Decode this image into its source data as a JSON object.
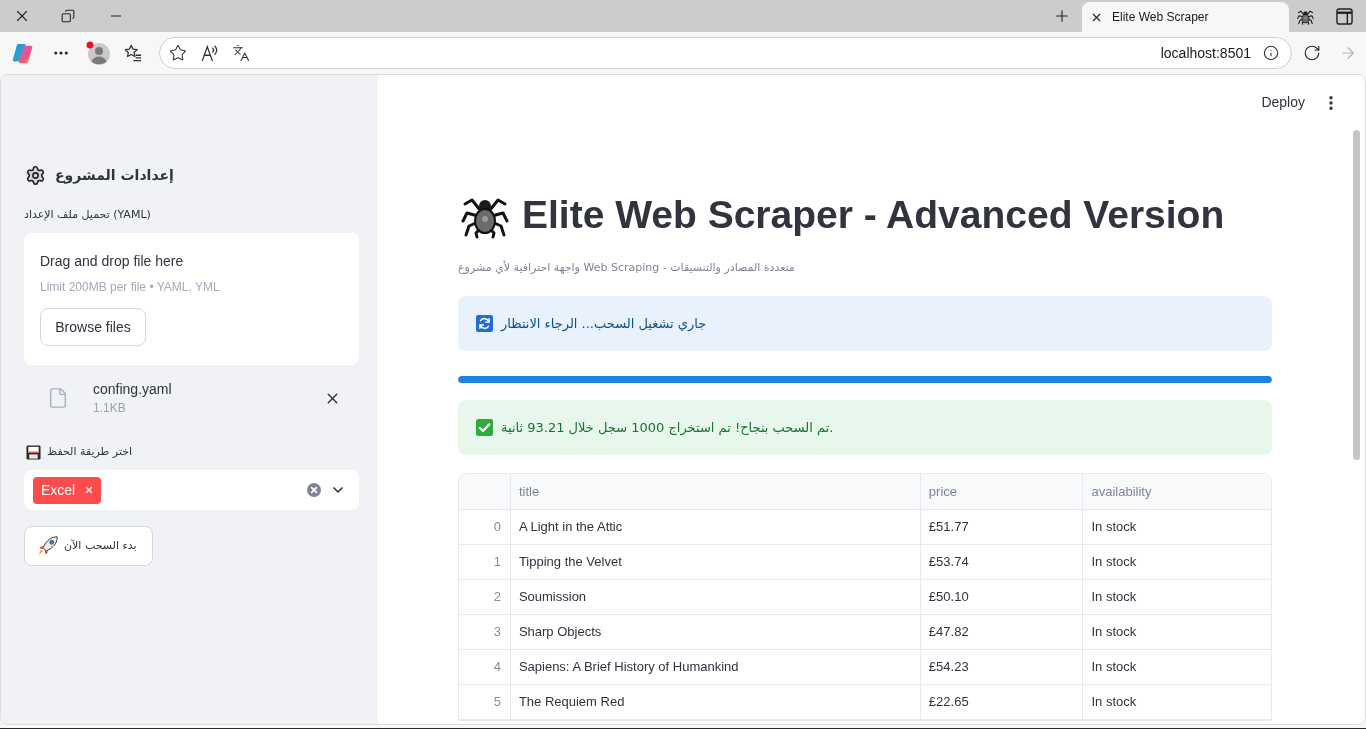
{
  "browser": {
    "tab_title": "Elite Web Scraper",
    "address": "localhost:8501"
  },
  "app_header": {
    "deploy_label": "Deploy"
  },
  "sidebar": {
    "title": "إعدادات المشروع",
    "uploader": {
      "label": "تحميل ملف الإعداد (YAML)",
      "drop_text": "Drag and drop file here",
      "limit_text": "Limit 200MB per file • YAML, YML",
      "browse_button": "Browse files"
    },
    "uploaded_file": {
      "name": "confing.yaml",
      "size": "1.1KB"
    },
    "save_method": {
      "label": "اختر طريقة الحفظ",
      "selected_options": [
        "Excel"
      ]
    },
    "start_button": "بدء السحب الآن"
  },
  "main": {
    "title": "Elite Web Scraper - Advanced Version",
    "subtitle": "واجهة احترافية لأي مشروع Web Scraping - متعددة المصادر والتنسيقات",
    "info_alert": "جاري تشغيل السحب... الرجاء الانتظار",
    "progress": {
      "level": 1
    },
    "success_alert": "تم السحب بنجاح! تم استخراج 1000 سجل خلال 93.21 ثانية.",
    "table": {
      "columns": [
        "title",
        "price",
        "availability"
      ],
      "rows": [
        {
          "index": "0",
          "cells": [
            "A Light in the Attic",
            "£51.77",
            "In stock"
          ]
        },
        {
          "index": "1",
          "cells": [
            "Tipping the Velvet",
            "£53.74",
            "In stock"
          ]
        },
        {
          "index": "2",
          "cells": [
            "Soumission",
            "£50.10",
            "In stock"
          ]
        },
        {
          "index": "3",
          "cells": [
            "Sharp Objects",
            "£47.82",
            "In stock"
          ]
        },
        {
          "index": "4",
          "cells": [
            "Sapiens: A Brief History of Humankind",
            "£54.23",
            "In stock"
          ]
        },
        {
          "index": "5",
          "cells": [
            "The Requiem Red",
            "£22.65",
            "In stock"
          ]
        }
      ]
    }
  }
}
